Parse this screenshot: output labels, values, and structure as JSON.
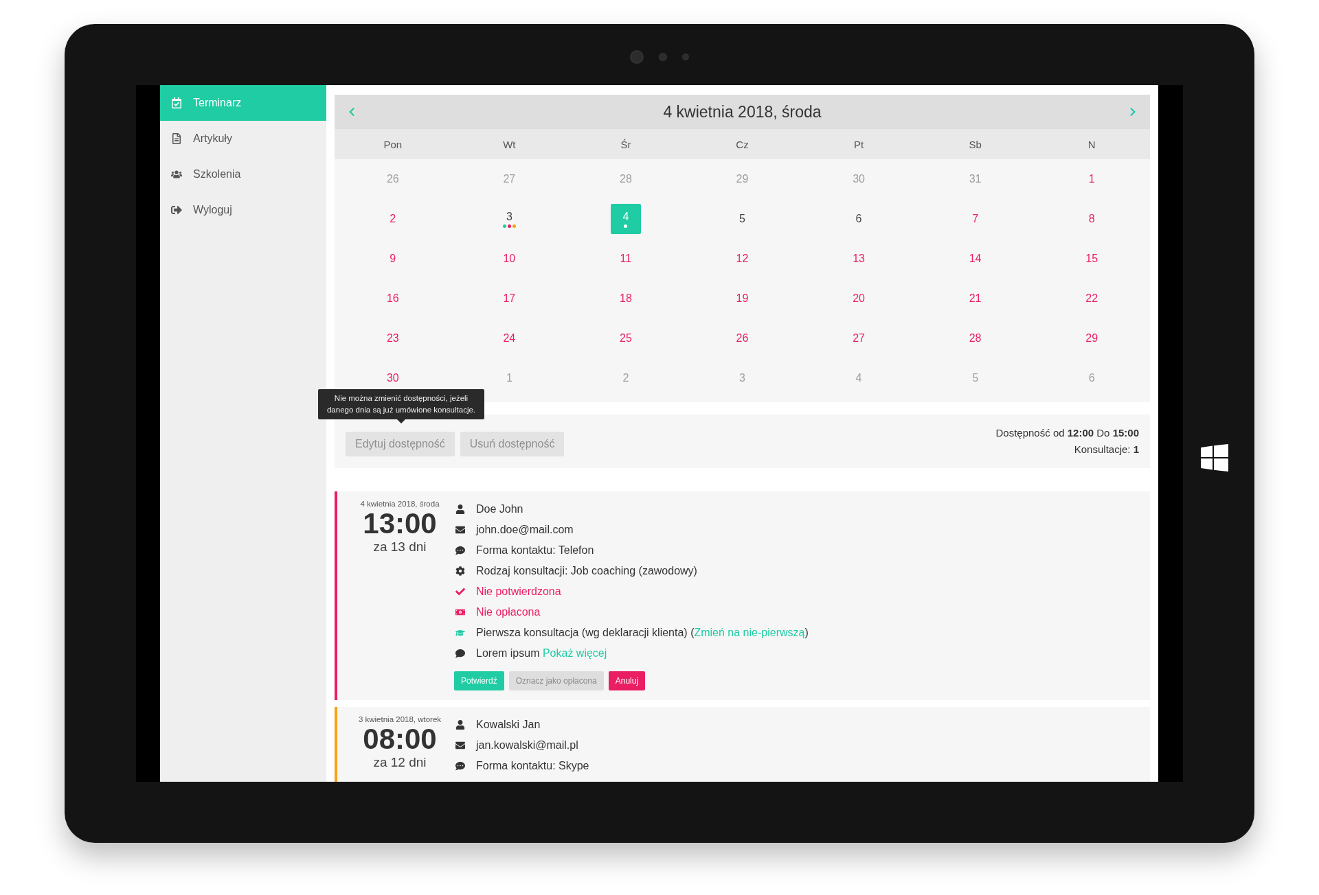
{
  "sidebar": {
    "items": [
      {
        "label": "Terminarz",
        "kind": "calendar",
        "selected": true
      },
      {
        "label": "Artykuły",
        "kind": "document",
        "selected": false
      },
      {
        "label": "Szkolenia",
        "kind": "users",
        "selected": false
      },
      {
        "label": "Wyloguj",
        "kind": "logout",
        "selected": false
      }
    ]
  },
  "calendar": {
    "title": "4 kwietnia 2018, środa",
    "weekdays": [
      "Pon",
      "Wt",
      "Śr",
      "Cz",
      "Pt",
      "Sb",
      "N"
    ],
    "weeks": [
      [
        {
          "day": "26",
          "kind": "outside",
          "selected": false
        },
        {
          "day": "27",
          "kind": "outside",
          "selected": false
        },
        {
          "day": "28",
          "kind": "outside",
          "selected": false
        },
        {
          "day": "29",
          "kind": "outside",
          "selected": false
        },
        {
          "day": "30",
          "kind": "outside",
          "selected": false
        },
        {
          "day": "31",
          "kind": "outside",
          "selected": false
        },
        {
          "day": "1",
          "kind": "available",
          "selected": false
        }
      ],
      [
        {
          "day": "2",
          "kind": "available",
          "selected": false
        },
        {
          "day": "3",
          "kind": "plain",
          "selected": false,
          "dots": [
            {
              "color": "#1fcca4"
            },
            {
              "color": "#ea1e63"
            },
            {
              "color": "#f7a21b"
            }
          ]
        },
        {
          "day": "4",
          "kind": "plain",
          "selected": true,
          "dots": [
            {
              "color": "#ffffff"
            }
          ]
        },
        {
          "day": "5",
          "kind": "plain",
          "selected": false
        },
        {
          "day": "6",
          "kind": "plain",
          "selected": false
        },
        {
          "day": "7",
          "kind": "available",
          "selected": false
        },
        {
          "day": "8",
          "kind": "available",
          "selected": false
        }
      ],
      [
        {
          "day": "9",
          "kind": "available",
          "selected": false
        },
        {
          "day": "10",
          "kind": "available",
          "selected": false
        },
        {
          "day": "11",
          "kind": "available",
          "selected": false
        },
        {
          "day": "12",
          "kind": "available",
          "selected": false
        },
        {
          "day": "13",
          "kind": "available",
          "selected": false
        },
        {
          "day": "14",
          "kind": "available",
          "selected": false
        },
        {
          "day": "15",
          "kind": "available",
          "selected": false
        }
      ],
      [
        {
          "day": "16",
          "kind": "available",
          "selected": false
        },
        {
          "day": "17",
          "kind": "available",
          "selected": false
        },
        {
          "day": "18",
          "kind": "available",
          "selected": false
        },
        {
          "day": "19",
          "kind": "available",
          "selected": false
        },
        {
          "day": "20",
          "kind": "available",
          "selected": false
        },
        {
          "day": "21",
          "kind": "available",
          "selected": false
        },
        {
          "day": "22",
          "kind": "available",
          "selected": false
        }
      ],
      [
        {
          "day": "23",
          "kind": "available",
          "selected": false
        },
        {
          "day": "24",
          "kind": "available",
          "selected": false
        },
        {
          "day": "25",
          "kind": "available",
          "selected": false
        },
        {
          "day": "26",
          "kind": "available",
          "selected": false
        },
        {
          "day": "27",
          "kind": "available",
          "selected": false
        },
        {
          "day": "28",
          "kind": "available",
          "selected": false
        },
        {
          "day": "29",
          "kind": "available",
          "selected": false
        }
      ],
      [
        {
          "day": "30",
          "kind": "available",
          "selected": false
        },
        {
          "day": "1",
          "kind": "outside",
          "selected": false
        },
        {
          "day": "2",
          "kind": "outside",
          "selected": false
        },
        {
          "day": "3",
          "kind": "outside",
          "selected": false
        },
        {
          "day": "4",
          "kind": "outside",
          "selected": false
        },
        {
          "day": "5",
          "kind": "outside",
          "selected": false
        },
        {
          "day": "6",
          "kind": "outside",
          "selected": false
        }
      ]
    ]
  },
  "availability": {
    "tooltip": "Nie można zmienić dostępności, jeżeli danego dnia są już umówione konsultacje.",
    "buttons": [
      {
        "label": "Edytuj dostępność",
        "disabled": true
      },
      {
        "label": "Usuń dostępność",
        "disabled": true
      }
    ],
    "summary": [
      "Dostępność od **12:00** Do **15:00**",
      "Konsultacje: **1**"
    ]
  },
  "appointments": [
    {
      "color": "#ea1e63",
      "date": "4 kwietnia 2018, środa",
      "time": "13:00",
      "relative": "za 13 dni",
      "details": [
        {
          "kind": "user",
          "alert": false,
          "text": "Doe John"
        },
        {
          "kind": "envelope",
          "alert": false,
          "text": "john.doe@mail.com"
        },
        {
          "kind": "chat",
          "alert": false,
          "text": "Forma kontaktu: Telefon"
        },
        {
          "kind": "gear",
          "alert": false,
          "text": "Rodzaj konsultacji: Job coaching (zawodowy)"
        },
        {
          "kind": "check",
          "alert": true,
          "text": "Nie potwierdzona"
        },
        {
          "kind": "money",
          "alert": true,
          "text": "Nie opłacona"
        },
        {
          "kind": "cap",
          "alert": false,
          "text": "Pierwsza konsultacja (wg deklaracji klienta) (",
          "link": "Zmień na nie-pierwszą",
          "after": ")"
        },
        {
          "kind": "comment",
          "alert": false,
          "text": "Lorem ipsum ",
          "link": "Pokaż więcej"
        }
      ],
      "actions": [
        {
          "label": "Potwierdź",
          "kind": "confirm",
          "disabled": false
        },
        {
          "label": "Oznacz jako opłacona",
          "kind": "pay",
          "disabled": true
        },
        {
          "label": "Anuluj",
          "kind": "cancel",
          "disabled": false
        }
      ]
    },
    {
      "color": "#f7a21b",
      "date": "3 kwietnia 2018, wtorek",
      "time": "08:00",
      "relative": "za 12 dni",
      "details": [
        {
          "kind": "user",
          "alert": false,
          "text": "Kowalski Jan"
        },
        {
          "kind": "envelope",
          "alert": false,
          "text": "jan.kowalski@mail.pl"
        },
        {
          "kind": "chat",
          "alert": false,
          "text": "Forma kontaktu: Skype"
        }
      ]
    }
  ]
}
